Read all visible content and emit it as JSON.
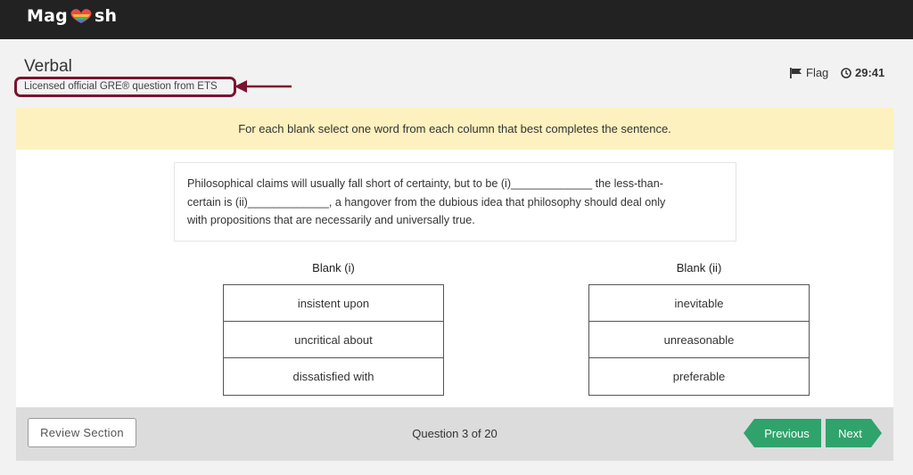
{
  "header": {
    "logo_left": "Mag",
    "logo_right": "sh"
  },
  "section": {
    "title": "Verbal",
    "license_note": "Licensed official GRE® question from ETS"
  },
  "toolbar": {
    "flag_label": "Flag",
    "timer": "29:41"
  },
  "question": {
    "instructions": "For each blank select one word from each column that best completes the sentence.",
    "passage_line_1": "Philosophical claims will usually fall short of certainty, but to be (i)_____________ the less-than-",
    "passage_line_2": "certain is (ii)_____________, a hangover from the dubious idea that philosophy should deal only",
    "passage_line_3": "with propositions that are necessarily and universally true.",
    "blank_1": {
      "label": "Blank (i)",
      "options": [
        "insistent upon",
        "uncritical about",
        "dissatisfied with"
      ]
    },
    "blank_2": {
      "label": "Blank (ii)",
      "options": [
        "inevitable",
        "unreasonable",
        "preferable"
      ]
    }
  },
  "footer": {
    "review_label": "Review Section",
    "question_count": "Question 3 of 20",
    "previous_label": "Previous",
    "next_label": "Next"
  },
  "colors": {
    "topbar": "#222222",
    "highlight_border": "#7a1430",
    "instructions_bg": "#fdf1bf",
    "nav_button": "#2fa36b"
  }
}
